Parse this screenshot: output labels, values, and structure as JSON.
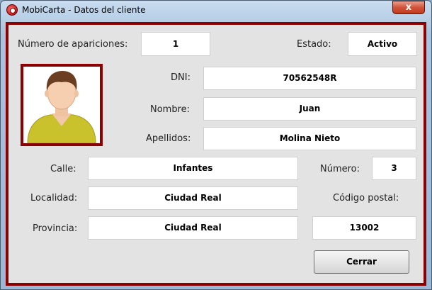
{
  "window": {
    "title": "MobiCarta - Datos del cliente",
    "close_label": "x"
  },
  "form": {
    "apariciones_label": "Número de apariciones:",
    "apariciones_value": "1",
    "estado_label": "Estado:",
    "estado_value": "Activo",
    "dni_label": "DNI:",
    "dni_value": "70562548R",
    "nombre_label": "Nombre:",
    "nombre_value": "Juan",
    "apellidos_label": "Apellidos:",
    "apellidos_value": "Molina Nieto",
    "calle_label": "Calle:",
    "calle_value": "Infantes",
    "numero_label": "Número:",
    "numero_value": "3",
    "localidad_label": "Localidad:",
    "localidad_value": "Ciudad Real",
    "codigo_postal_label": "Código postal:",
    "provincia_label": "Provincia:",
    "provincia_value": "Ciudad Real",
    "codigo_postal_value": "13002"
  },
  "buttons": {
    "cerrar_label": "Cerrar"
  },
  "colors": {
    "frame": "#8b0000",
    "panel": "#e3e3e3",
    "shirt": "#c8c82a"
  },
  "icons": {
    "app": "mobicarta-app-icon",
    "avatar": "user-avatar-icon"
  }
}
